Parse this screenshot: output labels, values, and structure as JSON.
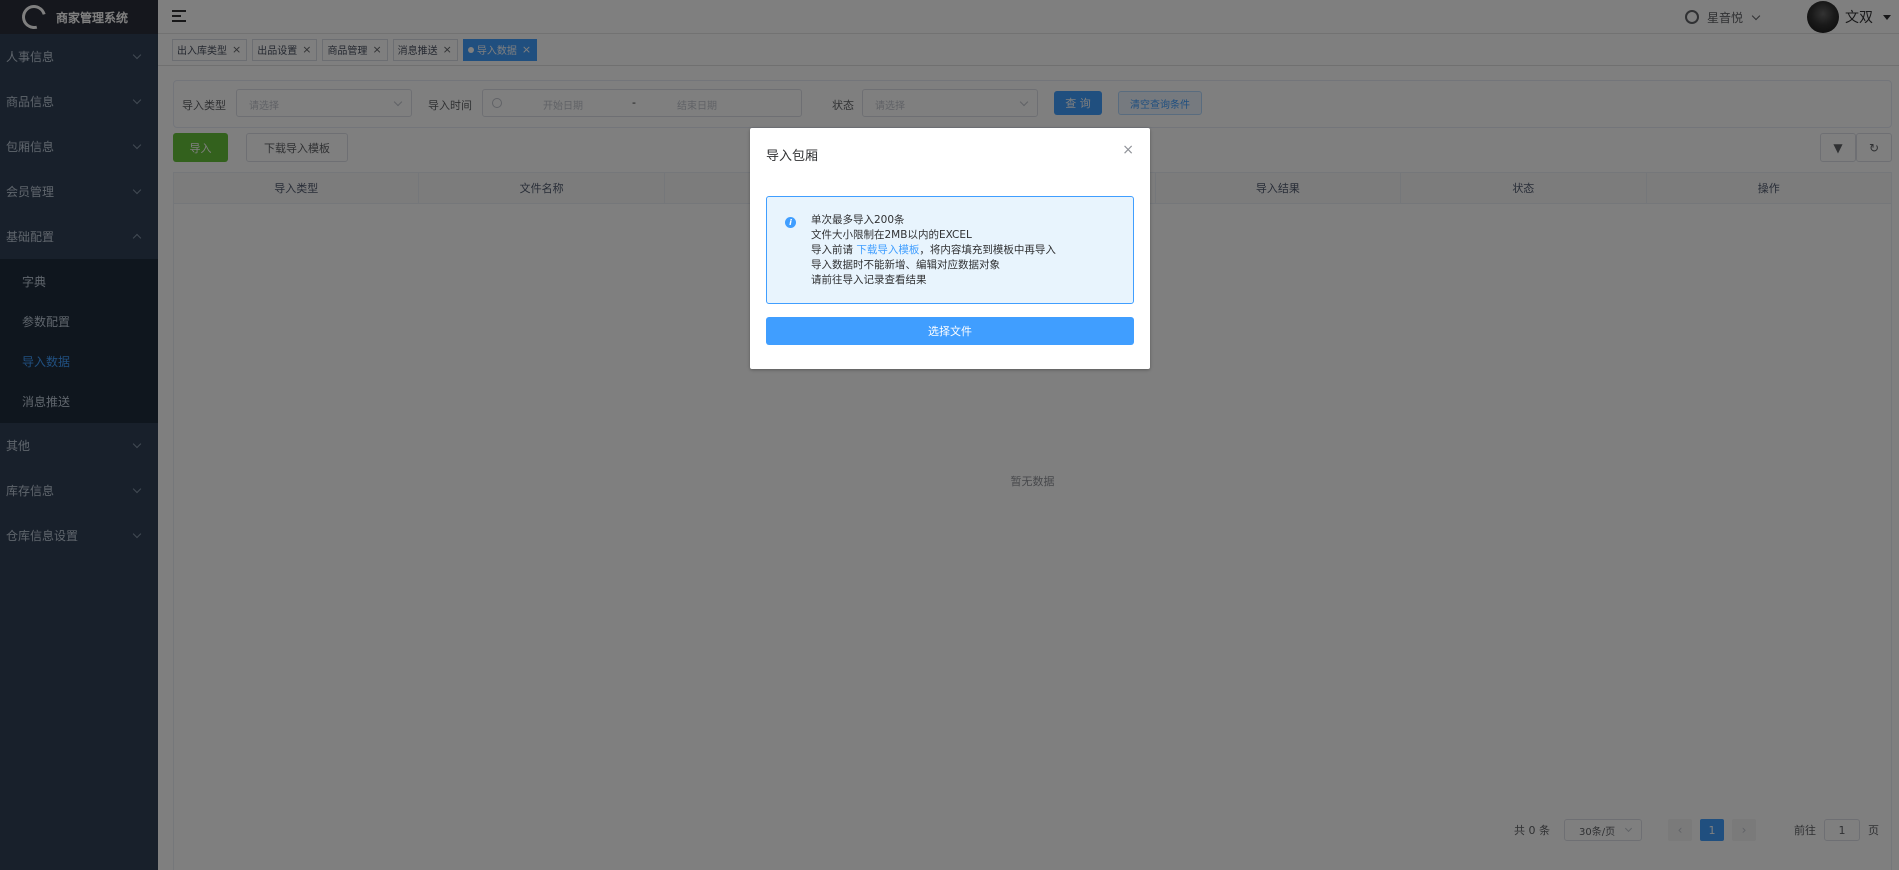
{
  "app": {
    "title": "商家管理系统"
  },
  "sidebar": {
    "menus": [
      {
        "label": "人事信息"
      },
      {
        "label": "商品信息"
      },
      {
        "label": "包厢信息"
      },
      {
        "label": "会员管理"
      },
      {
        "label": "基础配置",
        "expanded": true,
        "children": [
          "字典",
          "参数配置",
          "导入数据",
          "消息推送"
        ],
        "active_child": "导入数据"
      },
      {
        "label": "其他"
      },
      {
        "label": "库存信息"
      },
      {
        "label": "仓库信息设置"
      }
    ]
  },
  "header": {
    "org": "星音悦",
    "user": "文双"
  },
  "tags": [
    "出入库类型",
    "出品设置",
    "商品管理",
    "消息推送",
    "导入数据"
  ],
  "filters": {
    "type_label": "导入类型",
    "type_placeholder": "请选择",
    "time_label": "导入时间",
    "start_placeholder": "开始日期",
    "range_sep": "-",
    "end_placeholder": "结束日期",
    "status_label": "状态",
    "status_placeholder": "请选择",
    "query": "查 询",
    "clear": "清空查询条件"
  },
  "toolbar": {
    "import": "导入",
    "download_template": "下载导入模板"
  },
  "table": {
    "columns": [
      "导入类型",
      "文件名称",
      "",
      "",
      "导入结果",
      "状态",
      "操作"
    ],
    "empty_text": "暂无数据"
  },
  "pagination": {
    "total_text": "共 0 条",
    "page_size": "30条/页",
    "current_page": "1",
    "goto_label": "前往",
    "goto_value": "1",
    "page_suffix": "页"
  },
  "dialog": {
    "title": "导入包厢",
    "line1": "单次最多导入200条",
    "line2": "文件大小限制在2MB以内的EXCEL",
    "line3_pre": "导入前请",
    "line3_link": "下载导入模板",
    "line3_post": "，将内容填充到模板中再导入",
    "line4": "导入数据时不能新增、编辑对应数据对象",
    "line5": "请前往导入记录查看结果",
    "select_file": "选择文件"
  },
  "colors": {
    "primary": "#409eff",
    "success": "#67c23a",
    "sidebar": "#304156"
  }
}
